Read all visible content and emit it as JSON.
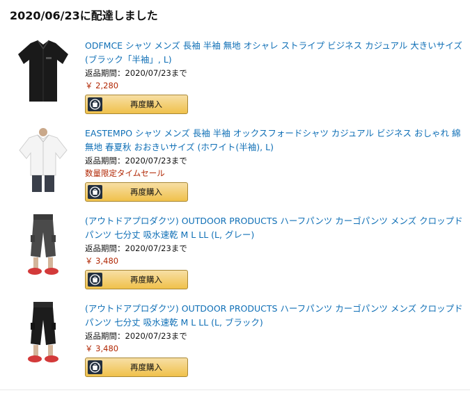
{
  "order": {
    "delivered_heading": "2020/06/23に配達しました"
  },
  "items": [
    {
      "title": "ODFMCE シャツ メンズ 長袖 半袖 無地 オシャレ ストライプ ビジネス カジュアル 大きいサイズ (ブラック「半袖」, L)",
      "return_period": "返品期間：2020/07/23まで",
      "price": "￥ 2,280",
      "deal": "",
      "buy_again_label": "再度購入",
      "image_color": "#1a1a1a"
    },
    {
      "title": "EASTEMPO シャツ メンズ 長袖 半袖 オックスフォードシャツ カジュアル ビジネス おしゃれ 綿 無地 春夏秋 おおきいサイズ (ホワイト(半袖), L)",
      "return_period": "返品期間：2020/07/23まで",
      "price": "",
      "deal": "数量限定タイムセール",
      "buy_again_label": "再度購入",
      "image_color": "#f4f4f4"
    },
    {
      "title": "(アウトドアプロダクツ) OUTDOOR PRODUCTS ハーフパンツ カーゴパンツ メンズ クロップドパンツ 七分丈 吸水速乾 M L LL (L, グレー)",
      "return_period": "返品期間：2020/07/23まで",
      "price": "￥ 3,480",
      "deal": "",
      "buy_again_label": "再度購入",
      "image_color": "#4a4a4a"
    },
    {
      "title": "(アウトドアプロダクツ) OUTDOOR PRODUCTS ハーフパンツ カーゴパンツ メンズ クロップドパンツ 七分丈 吸水速乾 M L LL (L, ブラック)",
      "return_period": "返品期間：2020/07/23まで",
      "price": "￥ 3,480",
      "deal": "",
      "buy_again_label": "再度購入",
      "image_color": "#1c1c1c"
    }
  ],
  "icons": {
    "buy_again": "reorder-bag-icon"
  },
  "colors": {
    "link": "#0f6fb6",
    "price": "#b12704",
    "button_top": "#f7dfa5",
    "button_bottom": "#f0c14b"
  }
}
